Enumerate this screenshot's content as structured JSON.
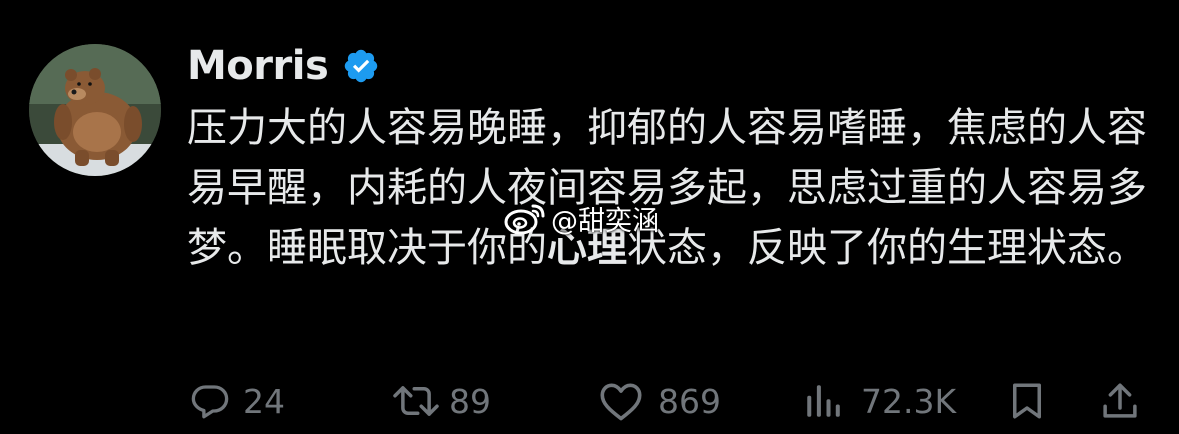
{
  "author": {
    "name": "Morris",
    "verified": true,
    "avatar_icon": "bear-avatar"
  },
  "tweet": {
    "text_before_bold": "压力大的人容易晚睡，抑郁的人容易嗜睡，焦虑的人容易早醒，内耗的人夜间容易多起，思虑过重的人容易多梦。睡眠取决于你的",
    "bold_text": "心理",
    "text_after_bold": "状态，反映了你的生理状态。"
  },
  "watermark": {
    "text": "@甜奕涵",
    "icon": "weibo-icon"
  },
  "actions": {
    "reply": {
      "icon": "reply-icon",
      "count": "24"
    },
    "retweet": {
      "icon": "retweet-icon",
      "count": "89"
    },
    "like": {
      "icon": "heart-icon",
      "count": "869"
    },
    "views": {
      "icon": "views-icon",
      "count": "72.3K"
    },
    "bookmark": {
      "icon": "bookmark-icon"
    },
    "share": {
      "icon": "share-icon"
    }
  },
  "colors": {
    "background": "#000000",
    "text": "#e7e9ea",
    "muted": "#71767b",
    "verified_blue": "#1d9bf0"
  }
}
